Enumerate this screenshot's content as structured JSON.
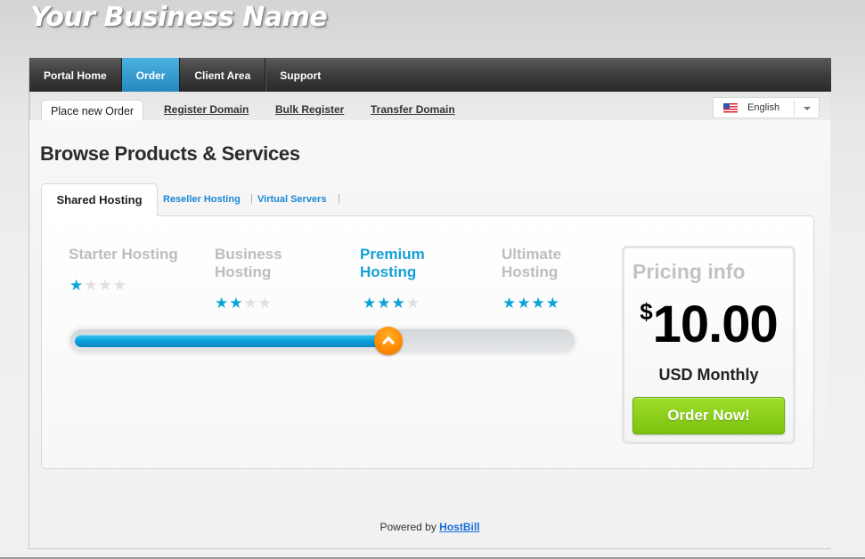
{
  "brand": {
    "name": "Your Business Name"
  },
  "top_nav": {
    "items": [
      {
        "label": "Portal Home",
        "active": false
      },
      {
        "label": "Order",
        "active": true
      },
      {
        "label": "Client Area",
        "active": false
      },
      {
        "label": "Support",
        "active": false
      }
    ]
  },
  "sub_nav": {
    "active_tab": "Place new Order",
    "links": [
      "Register Domain",
      "Bulk Register",
      "Transfer Domain"
    ]
  },
  "language": {
    "flag_icon": "us-flag-icon",
    "selected": "English"
  },
  "page": {
    "title": "Browse Products & Services"
  },
  "categories": {
    "active": "Shared Hosting",
    "others": [
      "Reseller Hosting",
      "Virtual Servers"
    ],
    "separator": "|"
  },
  "plans": [
    {
      "name": "Starter Hosting",
      "stars": 1,
      "max_stars": 4,
      "selected": false
    },
    {
      "name": "Business Hosting",
      "stars": 2,
      "max_stars": 4,
      "selected": false
    },
    {
      "name": "Premium Hosting",
      "stars": 3,
      "max_stars": 4,
      "selected": true
    },
    {
      "name": "Ultimate Hosting",
      "stars": 4,
      "max_stars": 4,
      "selected": false
    }
  ],
  "slider": {
    "selected_index": 2,
    "plan_count": 4,
    "position_fraction": 0.63
  },
  "pricing": {
    "title": "Pricing info",
    "currency_symbol": "$",
    "amount": "10.00",
    "period": "USD Monthly",
    "order_button": "Order Now!"
  },
  "colors": {
    "accent_blue": "#16a0d6",
    "nav_active": "#2f97cc",
    "order_green": "#8ccf1b",
    "slider_handle": "#ff8a00"
  },
  "footer": {
    "prefix": "Powered by",
    "link": "HostBill"
  }
}
